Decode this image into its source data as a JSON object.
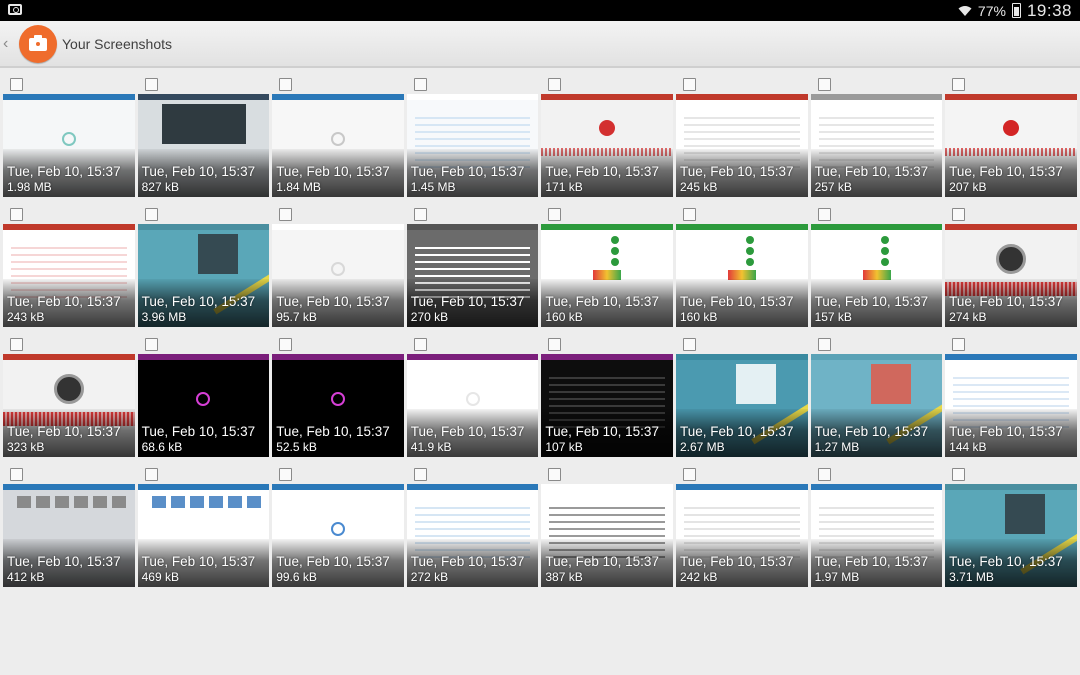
{
  "statusbar": {
    "battery": "77%",
    "time": "19:38"
  },
  "header": {
    "title": "Your Screenshots"
  },
  "screenshots": [
    {
      "date": "Tue, Feb 10, 15:37",
      "size": "1.98 MB",
      "bg": "#f5f7f8",
      "top": "#2a78b8",
      "style": "dot",
      "accent": "#7fc8c0"
    },
    {
      "date": "Tue, Feb 10, 15:37",
      "size": "827 kB",
      "bg": "#d8dde0",
      "top": "#34495e",
      "style": "panel",
      "accent": "#2f3a40"
    },
    {
      "date": "Tue, Feb 10, 15:37",
      "size": "1.84 MB",
      "bg": "#f7f7f7",
      "top": "#2a78b8",
      "style": "dot",
      "accent": "#c8c8c8"
    },
    {
      "date": "Tue, Feb 10, 15:37",
      "size": "1.45 MB",
      "bg": "#f7f9fb",
      "top": "#ffffff",
      "style": "list",
      "accent": "#d6e6f4"
    },
    {
      "date": "Tue, Feb 10, 15:37",
      "size": "171 kB",
      "bg": "#f2f2f2",
      "top": "#c0392b",
      "style": "wave",
      "accent": "#d33030"
    },
    {
      "date": "Tue, Feb 10, 15:37",
      "size": "245 kB",
      "bg": "#ffffff",
      "top": "#c0392b",
      "style": "list",
      "accent": "#e6e6e6"
    },
    {
      "date": "Tue, Feb 10, 15:37",
      "size": "257 kB",
      "bg": "#ffffff",
      "top": "#9a9a9a",
      "style": "list",
      "accent": "#e6e6e6"
    },
    {
      "date": "Tue, Feb 10, 15:37",
      "size": "207 kB",
      "bg": "#f4f4f4",
      "top": "#c0392b",
      "style": "wave",
      "accent": "#d32525"
    },
    {
      "date": "Tue, Feb 10, 15:37",
      "size": "243 kB",
      "bg": "#ffffff",
      "top": "#c0392b",
      "style": "list",
      "accent": "#f6d6d6"
    },
    {
      "date": "Tue, Feb 10, 15:37",
      "size": "3.96 MB",
      "bg": "#5aa7b8",
      "top": "#4a8fa0",
      "style": "lollipop",
      "accent": "#2f3a40"
    },
    {
      "date": "Tue, Feb 10, 15:37",
      "size": "95.7 kB",
      "bg": "#f5f5f5",
      "top": "#ffffff",
      "style": "dot",
      "accent": "#d8d8d8"
    },
    {
      "date": "Tue, Feb 10, 15:37",
      "size": "270 kB",
      "bg": "#6b6b6b",
      "top": "#555555",
      "style": "list",
      "accent": "#ffffff"
    },
    {
      "date": "Tue, Feb 10, 15:37",
      "size": "160 kB",
      "bg": "#ffffff",
      "top": "#2c9a3c",
      "style": "check",
      "accent": "#2c9a3c"
    },
    {
      "date": "Tue, Feb 10, 15:37",
      "size": "160 kB",
      "bg": "#ffffff",
      "top": "#2c9a3c",
      "style": "check",
      "accent": "#2c9a3c"
    },
    {
      "date": "Tue, Feb 10, 15:37",
      "size": "157 kB",
      "bg": "#ffffff",
      "top": "#2c9a3c",
      "style": "check",
      "accent": "#2c9a3c"
    },
    {
      "date": "Tue, Feb 10, 15:37",
      "size": "274 kB",
      "bg": "#f2f2f2",
      "top": "#c0392b",
      "style": "gauge",
      "accent": "#555555"
    },
    {
      "date": "Tue, Feb 10, 15:37",
      "size": "323 kB",
      "bg": "#f2f2f2",
      "top": "#c0392b",
      "style": "gauge",
      "accent": "#555555"
    },
    {
      "date": "Tue, Feb 10, 15:37",
      "size": "68.6 kB",
      "bg": "#000000",
      "top": "#7b1f7b",
      "style": "dot",
      "accent": "#d63fd6"
    },
    {
      "date": "Tue, Feb 10, 15:37",
      "size": "52.5 kB",
      "bg": "#000000",
      "top": "#7b1f7b",
      "style": "dot",
      "accent": "#d63fd6"
    },
    {
      "date": "Tue, Feb 10, 15:37",
      "size": "41.9 kB",
      "bg": "#ffffff",
      "top": "#7b1f7b",
      "style": "dot",
      "accent": "#e6e6e6"
    },
    {
      "date": "Tue, Feb 10, 15:37",
      "size": "107 kB",
      "bg": "#0d0d0d",
      "top": "#7b1f7b",
      "style": "list",
      "accent": "#3a3a3a"
    },
    {
      "date": "Tue, Feb 10, 15:37",
      "size": "2.67 MB",
      "bg": "#4b9ab0",
      "top": "#3a8aa0",
      "style": "lollipop",
      "accent": "#ffffff"
    },
    {
      "date": "Tue, Feb 10, 15:37",
      "size": "1.27 MB",
      "bg": "#6fb3c6",
      "top": "#5aa2b6",
      "style": "lollipop",
      "accent": "#e25a4a"
    },
    {
      "date": "Tue, Feb 10, 15:37",
      "size": "144 kB",
      "bg": "#ffffff",
      "top": "#2a78b8",
      "style": "list",
      "accent": "#dbe8f5"
    },
    {
      "date": "Tue, Feb 10, 15:37",
      "size": "412 kB",
      "bg": "#d5d8dc",
      "top": "#2a78b8",
      "style": "files",
      "accent": "#8a8a8a"
    },
    {
      "date": "Tue, Feb 10, 15:37",
      "size": "469 kB",
      "bg": "#ffffff",
      "top": "#2a78b8",
      "style": "files",
      "accent": "#5a8fc8"
    },
    {
      "date": "Tue, Feb 10, 15:37",
      "size": "99.6 kB",
      "bg": "#ffffff",
      "top": "#2a78b8",
      "style": "dot",
      "accent": "#4a8ad0"
    },
    {
      "date": "Tue, Feb 10, 15:37",
      "size": "272 kB",
      "bg": "#ffffff",
      "top": "#2a78b8",
      "style": "list",
      "accent": "#d6e6f4"
    },
    {
      "date": "Tue, Feb 10, 15:37",
      "size": "387 kB",
      "bg": "#ffffff",
      "top": "#ffffff",
      "style": "text",
      "accent": "#9a9a9a"
    },
    {
      "date": "Tue, Feb 10, 15:37",
      "size": "242 kB",
      "bg": "#ffffff",
      "top": "#2a78b8",
      "style": "list",
      "accent": "#e4e4e4"
    },
    {
      "date": "Tue, Feb 10, 15:37",
      "size": "1.97 MB",
      "bg": "#ffffff",
      "top": "#2a78b8",
      "style": "list",
      "accent": "#e4e4e4"
    },
    {
      "date": "Tue, Feb 10, 15:37",
      "size": "3.71 MB",
      "bg": "#5aa7b8",
      "top": "#4a8fa0",
      "style": "lollipop",
      "accent": "#2f3a40"
    }
  ]
}
